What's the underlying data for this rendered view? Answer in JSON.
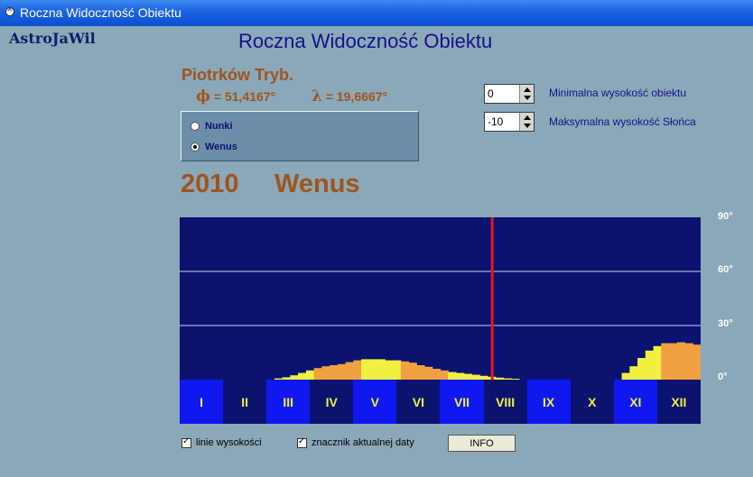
{
  "window": {
    "title": "Roczna Widoczność Obiektu"
  },
  "brand": "AstroJaWil",
  "heading": "Roczna Widoczność Obiektu",
  "location": {
    "name": "Piotrków Tryb.",
    "lat_symbol": "ϕ",
    "lat_value": "= 51,4167°",
    "lon_symbol": "λ",
    "lon_value": "= 19,6667°"
  },
  "objects": [
    {
      "label": "Nunki",
      "selected": false
    },
    {
      "label": "Wenus",
      "selected": true
    }
  ],
  "settings": {
    "min_altitude": {
      "value": "0",
      "label": "Minimalna wysokość obiektu"
    },
    "max_sun_altitude": {
      "value": "-10",
      "label": "Maksymalna wysokość Słońca"
    }
  },
  "display": {
    "year": "2010",
    "planet": "Wenus"
  },
  "chart_data": {
    "type": "bar",
    "y_ticks": [
      "90°",
      "60°",
      "30°",
      "0°"
    ],
    "ylim": [
      0,
      90
    ],
    "months": [
      "I",
      "II",
      "III",
      "IV",
      "V",
      "VI",
      "VII",
      "VIII",
      "IX",
      "X",
      "XI",
      "XII"
    ],
    "current_date_month_fraction": 7.2,
    "bar_colors": {
      "yellow": "#f0f040",
      "orange": "#f0a040"
    },
    "series": [
      {
        "values": [
          0,
          0,
          0,
          0,
          0,
          0,
          0,
          0,
          0,
          0,
          0,
          0,
          0,
          0,
          0,
          0,
          0,
          0,
          0,
          0,
          0,
          0,
          0,
          0,
          0,
          0,
          0,
          0,
          0,
          0,
          0,
          0,
          0,
          0,
          0,
          0,
          0,
          0,
          0,
          0,
          0,
          0,
          0,
          0,
          0,
          0,
          0,
          0,
          0,
          0,
          0,
          0,
          0,
          0,
          0,
          0,
          0,
          0,
          0,
          0
        ]
      },
      {
        "values": [
          0,
          0,
          0,
          0,
          0,
          0,
          0,
          0,
          0,
          0,
          0,
          0,
          0,
          0,
          0,
          0,
          0,
          0,
          0,
          0,
          0,
          0,
          0,
          0,
          0,
          0,
          0,
          0,
          0,
          0,
          0,
          0,
          0,
          0,
          0,
          0,
          0,
          0,
          0,
          0,
          0,
          0,
          0,
          0,
          0,
          0,
          0,
          0,
          0,
          0,
          0,
          0,
          0,
          0,
          0,
          0,
          0,
          0,
          0,
          0
        ]
      }
    ],
    "altitudes_deg": [
      0,
      0,
      0,
      0,
      0,
      0,
      0,
      0,
      0,
      0,
      0,
      0,
      0.7,
      1.3,
      2.4,
      3.7,
      5.1,
      6.4,
      7.4,
      8,
      8.6,
      9.7,
      10.7,
      11.3,
      11.3,
      11.3,
      10.7,
      10.7,
      10.1,
      9.4,
      8,
      7.1,
      6,
      5.1,
      4.2,
      3.7,
      3.2,
      2.7,
      2.1,
      1.6,
      1.1,
      0.7,
      0.5,
      0,
      0,
      0,
      0,
      0,
      0,
      0,
      0,
      0,
      0,
      0,
      0,
      0,
      3.7,
      7.4,
      12,
      16.1,
      18.6,
      20.2,
      20.2,
      20.7,
      20.2,
      19.4
    ],
    "bar_kinds": [
      "y",
      "y",
      "y",
      "y",
      "y",
      "y",
      "y",
      "y",
      "y",
      "y",
      "y",
      "y",
      "y",
      "y",
      "y",
      "y",
      "y",
      "o",
      "o",
      "o",
      "o",
      "o",
      "o",
      "y",
      "y",
      "y",
      "y",
      "y",
      "o",
      "o",
      "o",
      "o",
      "o",
      "o",
      "y",
      "y",
      "y",
      "y",
      "y",
      "y",
      "y",
      "y",
      "y",
      "y",
      "y",
      "y",
      "y",
      "y",
      "y",
      "y",
      "y",
      "y",
      "y",
      "y",
      "y",
      "y",
      "y",
      "y",
      "y",
      "y",
      "y",
      "o",
      "o",
      "o",
      "o",
      "o"
    ]
  },
  "options": {
    "grid_lines": {
      "label": "linie wysokości",
      "checked": true
    },
    "date_marker": {
      "label": "znacznik aktualnej daty",
      "checked": true
    },
    "info_button": "INFO"
  }
}
